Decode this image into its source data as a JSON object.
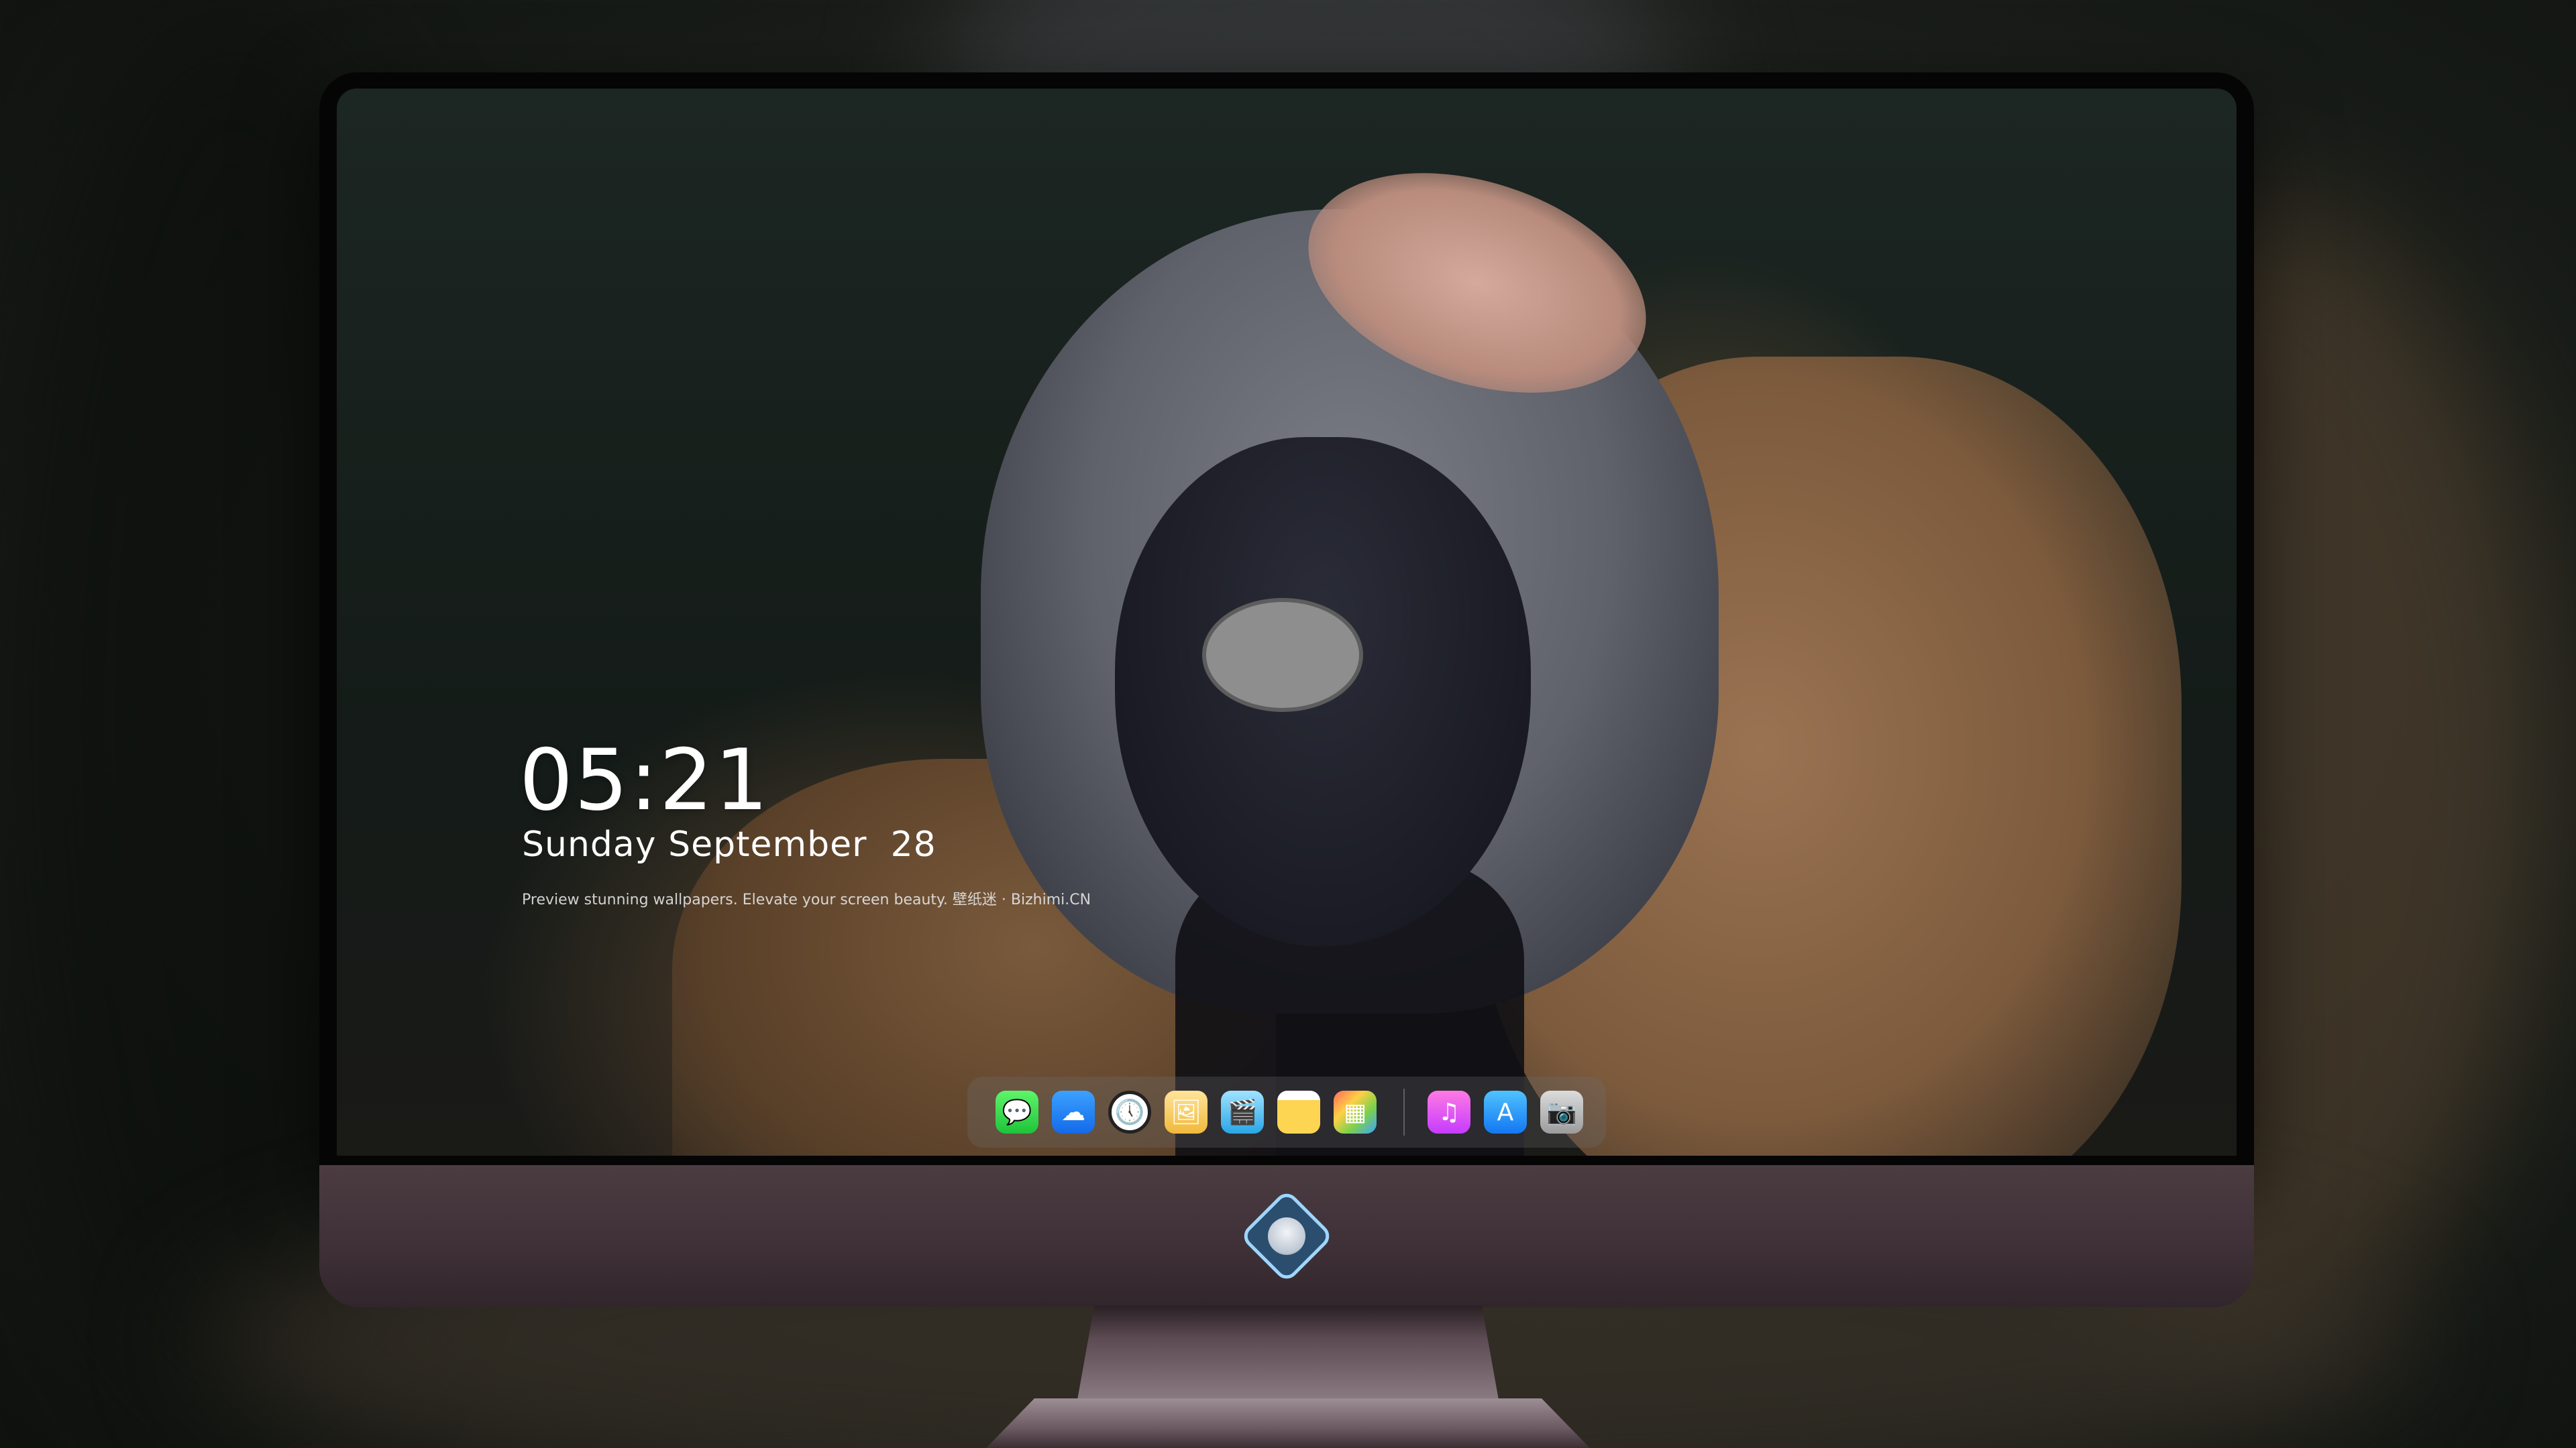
{
  "lockscreen": {
    "time": "05:21",
    "date": "Sunday September  28",
    "tagline": "Preview stunning wallpapers. Elevate your screen beauty. 壁纸迷 · Bizhimi.CN"
  },
  "dock": {
    "apps": [
      {
        "name": "messages-icon",
        "glyph": "💬"
      },
      {
        "name": "weather-icon",
        "glyph": "☁"
      },
      {
        "name": "clock-icon",
        "glyph": "🕔"
      },
      {
        "name": "preview-icon",
        "glyph": "🖼"
      },
      {
        "name": "clips-icon",
        "glyph": "🎬"
      },
      {
        "name": "notes-icon",
        "glyph": ""
      },
      {
        "name": "photos-icon",
        "glyph": "▦"
      },
      {
        "name": "music-icon",
        "glyph": "♫"
      },
      {
        "name": "app-store-icon",
        "glyph": "A"
      },
      {
        "name": "camera-icon",
        "glyph": "📷"
      }
    ]
  },
  "colors": {
    "monitor_bezel": "#050505",
    "chin": "#3f3137",
    "logo_border": "#9ed6ff"
  }
}
